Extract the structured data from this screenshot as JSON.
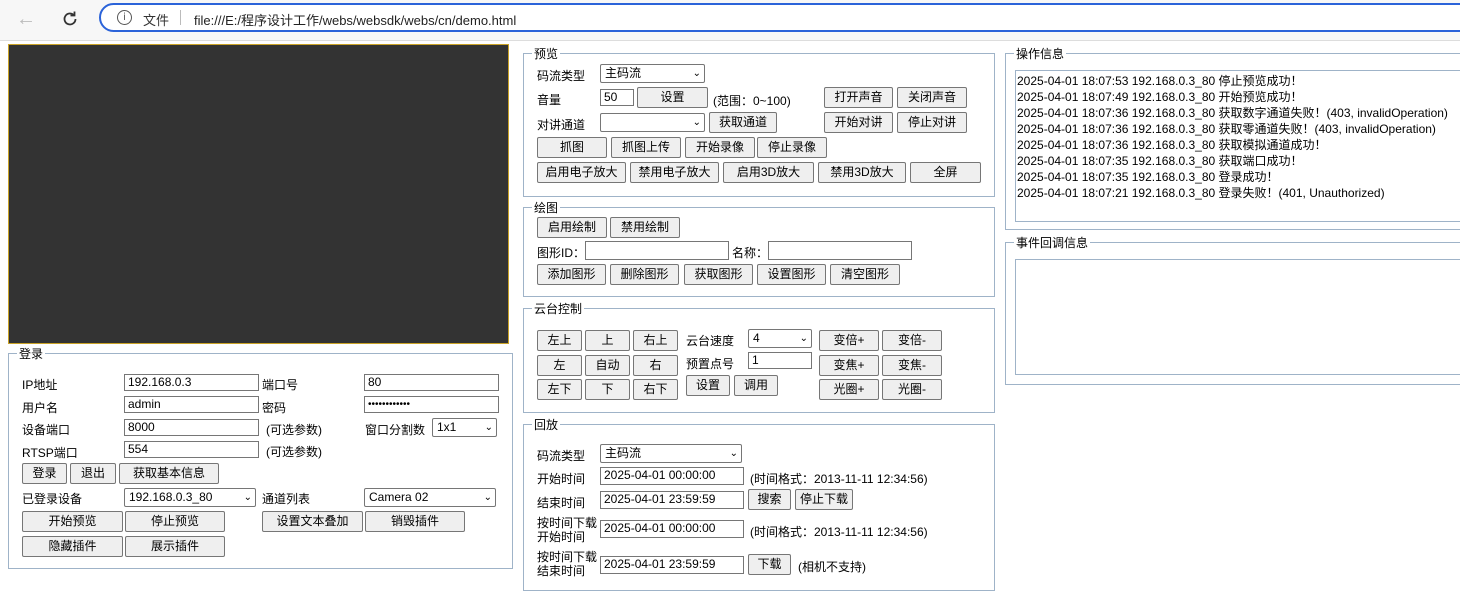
{
  "browser": {
    "back_icon": "arrow-left-icon",
    "reload_icon": "reload-icon",
    "protocol_label": "文件",
    "url": "file:///E:/程序设计工作/webs/websdk/webs/cn/demo.html"
  },
  "login": {
    "legend": "登录",
    "ip_label": "IP地址",
    "ip_value": "192.168.0.3",
    "port_label": "端口号",
    "port_value": "80",
    "user_label": "用户名",
    "user_value": "admin",
    "password_label": "密码",
    "password_value": "••••••••••••",
    "device_port_label": "设备端口",
    "device_port_value": "8000",
    "device_port_hint": "(可选参数)",
    "split_label": "窗口分割数",
    "split_value": "1x1",
    "rtsp_label": "RTSP端口",
    "rtsp_value": "554",
    "rtsp_hint": "(可选参数)",
    "login_btn": "登录",
    "logout_btn": "退出",
    "info_btn": "获取基本信息",
    "logged_device_label": "已登录设备",
    "logged_device_value": "192.168.0.3_80",
    "channel_list_label": "通道列表",
    "channel_list_value": "Camera 02",
    "start_preview_btn": "开始预览",
    "stop_preview_btn": "停止预览",
    "osd_btn": "设置文本叠加",
    "destroy_plugin_btn": "销毁插件",
    "hide_plugin_btn": "隐藏插件",
    "show_plugin_btn": "展示插件"
  },
  "preview": {
    "legend": "预览",
    "stream_type_label": "码流类型",
    "stream_type_value": "主码流",
    "volume_label": "音量",
    "volume_value": "50",
    "set_btn": "设置",
    "volume_range": "(范围：0~100)",
    "open_sound_btn": "打开声音",
    "close_sound_btn": "关闭声音",
    "talk_channel_label": "对讲通道",
    "talk_channel_value": "",
    "get_channel_btn": "获取通道",
    "start_talk_btn": "开始对讲",
    "stop_talk_btn": "停止对讲",
    "capture_btn": "抓图",
    "capture_upload_btn": "抓图上传",
    "start_record_btn": "开始录像",
    "stop_record_btn": "停止录像",
    "enable_ezoom_btn": "启用电子放大",
    "disable_ezoom_btn": "禁用电子放大",
    "enable_3d_btn": "启用3D放大",
    "disable_3d_btn": "禁用3D放大",
    "fullscreen_btn": "全屏"
  },
  "draw": {
    "legend": "绘图",
    "enable_btn": "启用绘制",
    "disable_btn": "禁用绘制",
    "shape_id_label": "图形ID：",
    "shape_id_value": "",
    "name_label": "名称：",
    "name_value": "",
    "add_btn": "添加图形",
    "delete_btn": "删除图形",
    "get_btn": "获取图形",
    "set_btn": "设置图形",
    "clear_btn": "清空图形"
  },
  "ptz": {
    "legend": "云台控制",
    "up_left": "左上",
    "up": "上",
    "up_right": "右上",
    "left": "左",
    "auto": "自动",
    "right": "右",
    "down_left": "左下",
    "down": "下",
    "down_right": "右下",
    "speed_label": "云台速度",
    "speed_value": "4",
    "preset_label": "预置点号",
    "preset_value": "1",
    "set_btn": "设置",
    "call_btn": "调用",
    "zoom_in": "变倍+",
    "zoom_out": "变倍-",
    "focus_in": "变焦+",
    "focus_out": "变焦-",
    "iris_in": "光圈+",
    "iris_out": "光圈-"
  },
  "playback": {
    "legend": "回放",
    "stream_type_label": "码流类型",
    "stream_type_value": "主码流",
    "start_time_label": "开始时间",
    "start_time_value": "2025-04-01 00:00:00",
    "time_format_hint": "(时间格式：2013-11-11 12:34:56)",
    "end_time_label": "结束时间",
    "end_time_value": "2025-04-01 23:59:59",
    "search_btn": "搜索",
    "stop_download_btn": "停止下载",
    "dl_start_label_1": "按时间下载",
    "dl_start_label_2": "开始时间",
    "dl_start_value": "2025-04-01 00:00:00",
    "dl_time_format_hint": "(时间格式：2013-11-11 12:34:56)",
    "dl_end_label_1": "按时间下载",
    "dl_end_label_2": "结束时间",
    "dl_end_value": "2025-04-01 23:59:59",
    "download_btn": "下载",
    "unsupported_hint": "(相机不支持)"
  },
  "op_info": {
    "legend": "操作信息",
    "lines": [
      "2025-04-01 18:07:53 192.168.0.3_80 停止预览成功！",
      "2025-04-01 18:07:49 192.168.0.3_80 开始预览成功！",
      "2025-04-01 18:07:36 192.168.0.3_80 获取数字通道失败！(403, invalidOperation)",
      "2025-04-01 18:07:36 192.168.0.3_80 获取零通道失败！(403, invalidOperation)",
      "2025-04-01 18:07:36 192.168.0.3_80 获取模拟通道成功！",
      "2025-04-01 18:07:35 192.168.0.3_80 获取端口成功！",
      "2025-04-01 18:07:35 192.168.0.3_80 登录成功！",
      "2025-04-01 18:07:21 192.168.0.3_80 登录失败！(401, Unauthorized)"
    ]
  },
  "event_info": {
    "legend": "事件回调信息"
  }
}
